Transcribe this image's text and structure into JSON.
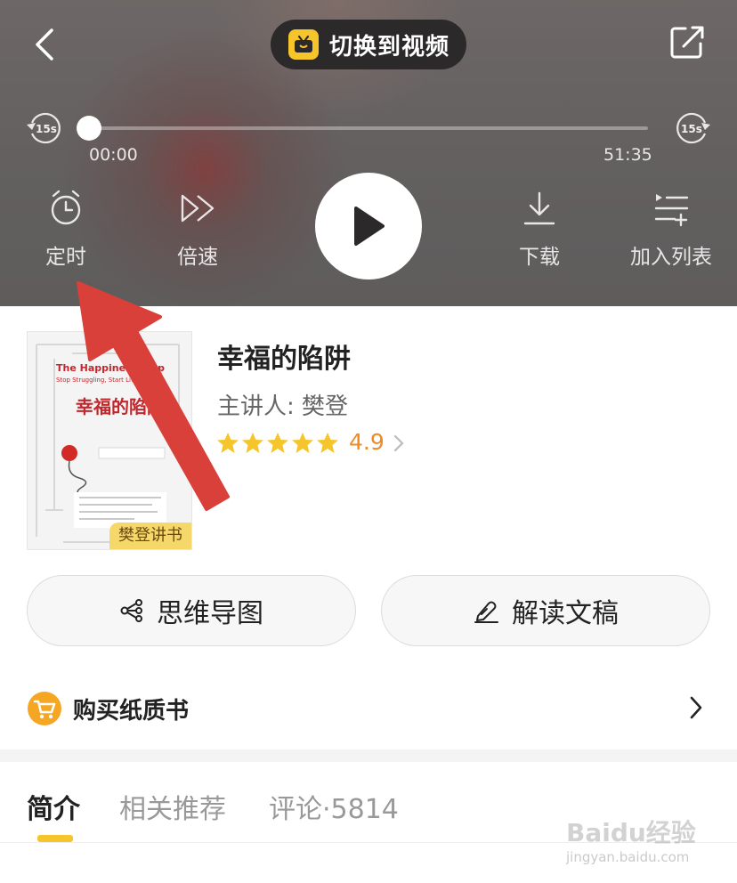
{
  "player": {
    "switch_label": "切换到视频",
    "skip_back": "15s",
    "skip_forward": "15s",
    "time_current": "00:00",
    "time_total": "51:35",
    "progress": 0,
    "controls": {
      "timer": "定时",
      "speed": "倍速",
      "download": "下载",
      "add_list": "加入列表"
    }
  },
  "book": {
    "cover": {
      "en_title": "The Happiness Trap",
      "en_subtitle": "Stop Struggling, Start Living",
      "cn_title": "幸福的陷阱",
      "badge": "樊登讲书"
    },
    "title": "幸福的陷阱",
    "speaker": "主讲人: 樊登",
    "rating": "4.9",
    "stars": 5
  },
  "actions": {
    "mind_map": "思维导图",
    "transcript": "解读文稿"
  },
  "buy": {
    "label": "购买纸质书"
  },
  "tabs": [
    {
      "label": "简介"
    },
    {
      "label": "相关推荐"
    },
    {
      "label": "评论·5814"
    }
  ],
  "watermark": {
    "line1": "Baidu经验",
    "line2": "jingyan.baidu.com"
  },
  "colors": {
    "accent_yellow": "#f6c52b",
    "rating_orange": "#f08a24",
    "annotation_red": "#d9403a"
  }
}
